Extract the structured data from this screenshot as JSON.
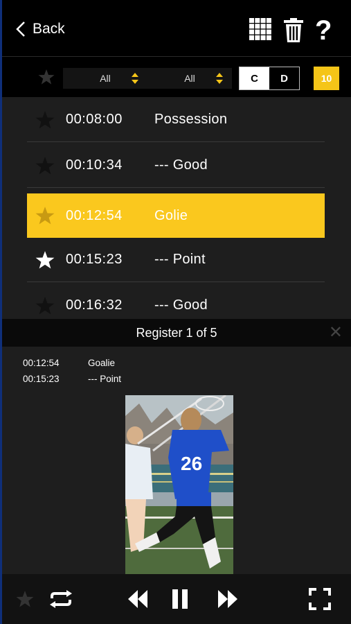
{
  "header": {
    "back_label": "Back",
    "icons": [
      "grid-icon",
      "trash-icon",
      "help-icon"
    ],
    "help_glyph": "?"
  },
  "filters": {
    "select_1": "All",
    "select_2": "All",
    "toggle_c": "C",
    "toggle_d": "D",
    "toggle_active": "C",
    "count_badge": "10"
  },
  "events": [
    {
      "time": "00:08:00",
      "label": "Possession",
      "starred": false,
      "selected": false
    },
    {
      "time": "00:10:34",
      "label": "--- Good",
      "starred": false,
      "selected": false
    },
    {
      "time": "00:12:54",
      "label": "Golie",
      "starred": false,
      "selected": true
    },
    {
      "time": "00:15:23",
      "label": "--- Point",
      "starred": true,
      "selected": false
    },
    {
      "time": "00:16:32",
      "label": "--- Good",
      "starred": false,
      "selected": false
    }
  ],
  "register": {
    "title": "Register 1 of 5",
    "close_glyph": "✕",
    "entries": [
      {
        "time": "00:12:54",
        "label": "Goalie"
      },
      {
        "time": "00:15:23",
        "label": "--- Point"
      }
    ],
    "jersey_number": "26"
  },
  "controls": [
    "star-icon",
    "loop-icon",
    "rewind-icon",
    "pause-icon",
    "fast-forward-icon",
    "fullscreen-icon"
  ],
  "colors": {
    "accent": "#fac81e",
    "background": "#1e1e1e",
    "dark": "#000000",
    "jersey": "#1f4fc9"
  }
}
